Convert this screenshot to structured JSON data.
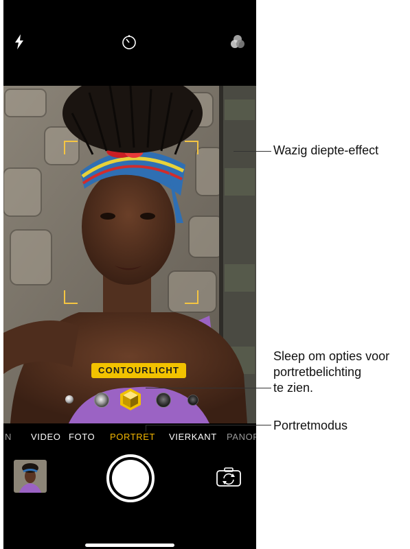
{
  "topbar": {
    "icons": [
      "flash-icon",
      "timer-icon",
      "filters-icon"
    ]
  },
  "viewfinder": {
    "lighting_label": "CONTOURLICHT",
    "lighting_options": [
      "natural-light",
      "studio-light",
      "contour-light",
      "stage-light",
      "stage-light-mono"
    ],
    "selected_lighting_index": 2
  },
  "modes": {
    "items": [
      "N",
      "VIDEO",
      "FOTO",
      "PORTRET",
      "VIERKANT",
      "PANOR"
    ],
    "active": "PORTRET"
  },
  "bottombar": {
    "icons": [
      "last-photo-thumbnail",
      "shutter-button",
      "flip-camera-icon"
    ]
  },
  "callouts": {
    "depth": "Wazig diepte-effect",
    "lighting_line1": "Sleep om opties voor",
    "lighting_line2": "portretbelichting",
    "lighting_line3": "te zien.",
    "mode": "Portretmodus"
  },
  "colors": {
    "accent": "#f5b700",
    "badge": "#f2c200",
    "bracket": "#f5c542",
    "background": "#000000"
  }
}
